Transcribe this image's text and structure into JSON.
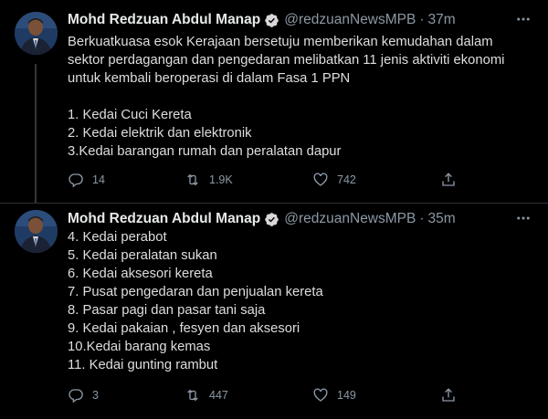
{
  "tweets": [
    {
      "author_name": "Mohd Redzuan Abdul Manap",
      "handle": "@redzuanNewsMPB",
      "separator": "·",
      "time": "37m",
      "lines": [
        "Berkuatkuasa esok Kerajaan bersetuju memberikan kemudahan dalam",
        "sektor perdagangan dan pengedaran melibatkan 11 jenis aktiviti ekonomi",
        "untuk kembali beroperasi di dalam Fasa 1 PPN",
        "",
        "1. Kedai Cuci Kereta",
        "2. Kedai elektrik dan elektronik",
        "3.Kedai barangan rumah dan peralatan dapur"
      ],
      "replies": "14",
      "retweets": "1.9K",
      "likes": "742"
    },
    {
      "author_name": "Mohd Redzuan Abdul Manap",
      "handle": "@redzuanNewsMPB",
      "separator": "·",
      "time": "35m",
      "lines": [
        "4. Kedai perabot",
        "5. Kedai peralatan sukan",
        "6. Kedai aksesori kereta",
        "7. Pusat pengedaran dan penjualan kereta",
        "8. Pasar pagi dan pasar tani saja",
        "9. Kedai pakaian , fesyen dan aksesori",
        "10.Kedai barang kemas",
        "11. Kedai gunting rambut"
      ],
      "replies": "3",
      "retweets": "447",
      "likes": "149"
    }
  ],
  "icons": {
    "more": "more-horizontal-icon",
    "verified": "verified-badge-icon",
    "reply": "reply-icon",
    "retweet": "retweet-icon",
    "like": "heart-icon",
    "share": "share-icon"
  },
  "colors": {
    "background": "#000000",
    "text": "#e7e9ea",
    "secondary": "#8b98a5",
    "verified": "#d9d9d9",
    "divider": "#2f3336"
  }
}
